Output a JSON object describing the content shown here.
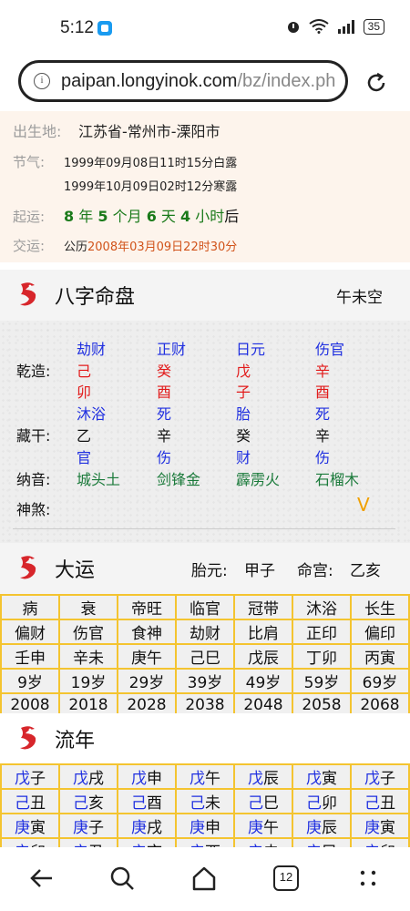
{
  "status_bar": {
    "time": "5:12",
    "battery": "35"
  },
  "browser": {
    "url_host": "paipan.longyinok.com",
    "url_path": "/bz/index.ph",
    "tabs_count": "12"
  },
  "info": {
    "birthplace_label": "出生地:",
    "birthplace_value": "江苏省-常州市-溧阳市",
    "jieqi_label": "节气:",
    "jieqi_line1": "1999年09月08日11时15分白露",
    "jieqi_line2": "1999年10月09日02时12分寒露",
    "qiyun_label": "起运:",
    "qiyun": {
      "years": "8",
      "year_unit": "年",
      "months": "5",
      "month_unit": "个月",
      "days": "6",
      "day_unit": "天",
      "hours": "4",
      "hour_unit": "小时",
      "suffix": "后"
    },
    "jiaoyun_label": "交运:",
    "jiaoyun_prefix": "公历",
    "jiaoyun_date": "2008年03月09日22时30分"
  },
  "bazi": {
    "title": "八字命盘",
    "kongwang": "午未空",
    "qianzao_label": "乾造:",
    "canggan_label": "藏干:",
    "nayin_label": "纳音:",
    "shensha_label": "神煞:",
    "shensha_toggle": "V",
    "columns": [
      {
        "shishen": "劫财",
        "gan": "己",
        "zhi": "卯",
        "state": "沐浴",
        "canggan": "乙",
        "canggan_shishen": "官",
        "nayin": "城头土"
      },
      {
        "shishen": "正财",
        "gan": "癸",
        "zhi": "酉",
        "state": "死",
        "canggan": "辛",
        "canggan_shishen": "伤",
        "nayin": "剑锋金"
      },
      {
        "shishen": "日元",
        "gan": "戊",
        "zhi": "子",
        "state": "胎",
        "canggan": "癸",
        "canggan_shishen": "财",
        "nayin": "霹雳火"
      },
      {
        "shishen": "伤官",
        "gan": "辛",
        "zhi": "酉",
        "state": "死",
        "canggan": "辛",
        "canggan_shishen": "伤",
        "nayin": "石榴木"
      }
    ]
  },
  "dayun": {
    "title": "大运",
    "taiyuan_label": "胎元:",
    "taiyuan": "甲子",
    "minggong_label": "命宫:",
    "minggong": "乙亥",
    "rows": [
      [
        "病",
        "衰",
        "帝旺",
        "临官",
        "冠带",
        "沐浴",
        "长生"
      ],
      [
        "偏财",
        "伤官",
        "食神",
        "劫财",
        "比肩",
        "正印",
        "偏印"
      ],
      [
        "壬申",
        "辛未",
        "庚午",
        "己巳",
        "戊辰",
        "丁卯",
        "丙寅"
      ],
      [
        "9岁",
        "19岁",
        "29岁",
        "39岁",
        "49岁",
        "59岁",
        "69岁"
      ],
      [
        "2008",
        "2018",
        "2028",
        "2038",
        "2048",
        "2058",
        "2068"
      ]
    ]
  },
  "liunian": {
    "title": "流年",
    "rows": [
      [
        [
          "戊",
          "子"
        ],
        [
          "戊",
          "戌"
        ],
        [
          "戊",
          "申"
        ],
        [
          "戊",
          "午"
        ],
        [
          "戊",
          "辰"
        ],
        [
          "戊",
          "寅"
        ],
        [
          "戊",
          "子"
        ]
      ],
      [
        [
          "己",
          "丑"
        ],
        [
          "己",
          "亥"
        ],
        [
          "己",
          "酉"
        ],
        [
          "己",
          "未"
        ],
        [
          "己",
          "巳"
        ],
        [
          "己",
          "卯"
        ],
        [
          "己",
          "丑"
        ]
      ],
      [
        [
          "庚",
          "寅"
        ],
        [
          "庚",
          "子"
        ],
        [
          "庚",
          "戌"
        ],
        [
          "庚",
          "申"
        ],
        [
          "庚",
          "午"
        ],
        [
          "庚",
          "辰"
        ],
        [
          "庚",
          "寅"
        ]
      ],
      [
        [
          "辛",
          "卯"
        ],
        [
          "辛",
          "丑"
        ],
        [
          "辛",
          "亥"
        ],
        [
          "辛",
          "酉"
        ],
        [
          "辛",
          "未"
        ],
        [
          "辛",
          "巳"
        ],
        [
          "辛",
          "卯"
        ]
      ]
    ]
  },
  "colors": {
    "accent_yellow": "#f4c430",
    "blue_text": "#1f2fe0",
    "red_text": "#e21a1a",
    "green_text": "#1a7a3a",
    "info_bg": "#fdf4ec"
  }
}
